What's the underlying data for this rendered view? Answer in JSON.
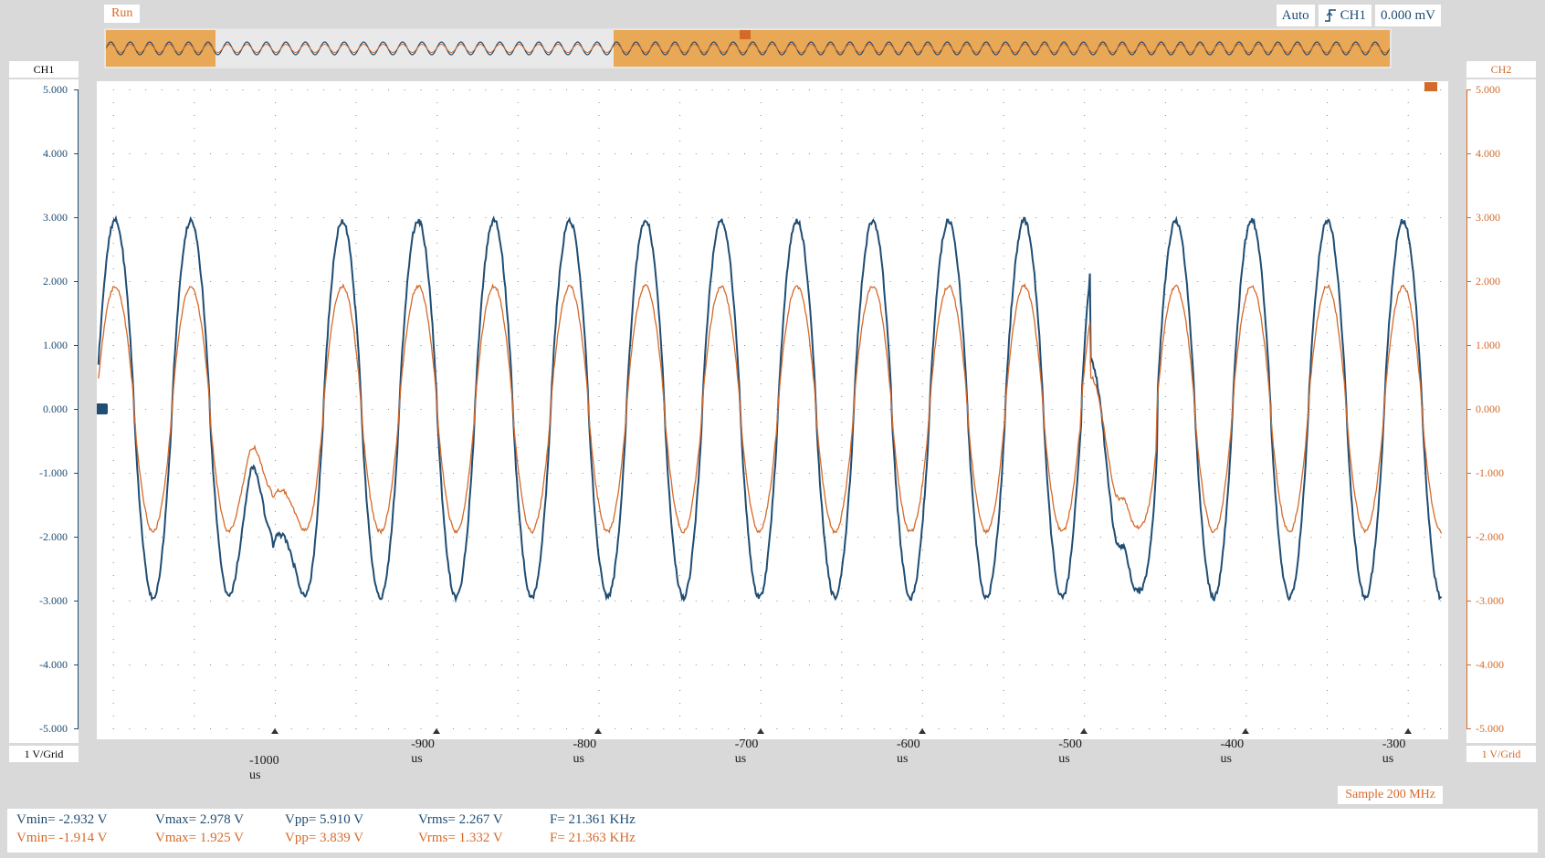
{
  "status": {
    "run_label": "Run"
  },
  "trigger": {
    "mode": "Auto",
    "source": "CH1",
    "level": "0.000 mV"
  },
  "colors": {
    "ch1": "#1f4d73",
    "ch2": "#d46a2a"
  },
  "ch1_axis": {
    "title": "CH1",
    "scale": "1 V/Grid",
    "ticks": [
      "5.000",
      "4.000",
      "3.000",
      "2.000",
      "1.000",
      "0.000",
      "-1.000",
      "-2.000",
      "-3.000",
      "-4.000",
      "-5.000"
    ]
  },
  "ch2_axis": {
    "title": "CH2",
    "scale": "1 V/Grid",
    "ticks": [
      "5.000",
      "4.000",
      "3.000",
      "2.000",
      "1.000",
      "0.000",
      "-1.000",
      "-2.000",
      "-3.000",
      "-4.000",
      "-5.000"
    ]
  },
  "time_axis": {
    "labels": [
      "-1000 us",
      "-900 us",
      "-800 us",
      "-700 us",
      "-600 us",
      "-500 us",
      "-400 us",
      "-300 us"
    ]
  },
  "sample_rate": "Sample 200 MHz",
  "measurements": {
    "ch1": {
      "vmin": "Vmin= -2.932 V",
      "vmax": "Vmax= 2.978 V",
      "vpp": "Vpp= 5.910 V",
      "vrms": "Vrms= 2.267 V",
      "freq": "F= 21.361 KHz"
    },
    "ch2": {
      "vmin": "Vmin= -1.914 V",
      "vmax": "Vmax= 1.925 V",
      "vpp": "Vpp= 3.839 V",
      "vrms": "Vrms= 1.332 V",
      "freq": "F= 21.363 KHz"
    }
  },
  "chart_data": {
    "type": "line",
    "x_unit": "us",
    "xlim": [
      -1110,
      -275
    ],
    "ylim": [
      -5,
      5
    ],
    "grid": true,
    "series": [
      {
        "name": "CH1",
        "amplitude": 2.95,
        "frequency_khz": 21.361,
        "dropouts_us": [
          -1001,
          -476
        ]
      },
      {
        "name": "CH2",
        "amplitude": 1.92,
        "frequency_khz": 21.363,
        "dropouts_us": [
          -1001,
          -476
        ]
      }
    ]
  }
}
